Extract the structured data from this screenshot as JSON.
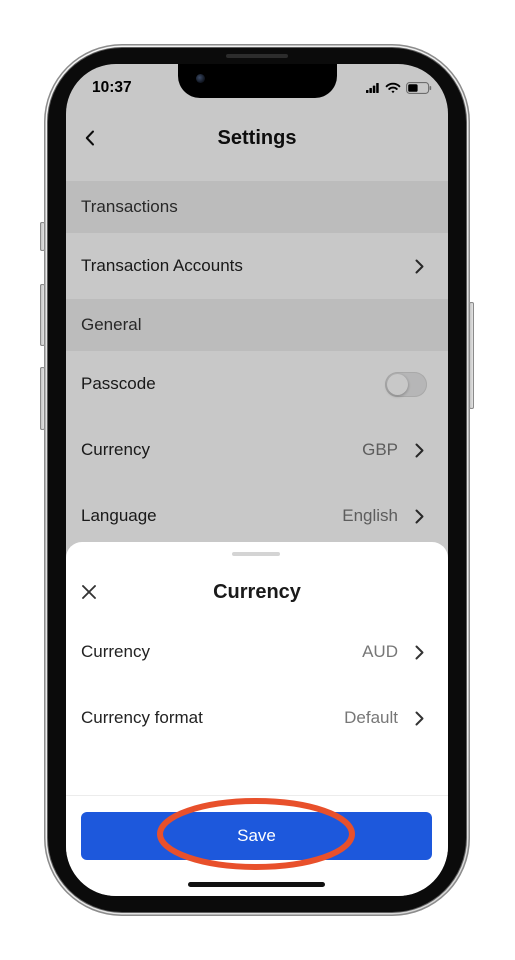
{
  "status_bar": {
    "time": "10:37",
    "signal_bars": 4,
    "signal_bars_max": 4,
    "battery_level": 0.5,
    "icons": {
      "signal": "signal-icon",
      "wifi": "wifi-icon",
      "battery": "battery-icon"
    }
  },
  "settings": {
    "title": "Settings",
    "back_icon": "chevron-left-icon",
    "sections": [
      {
        "header": "Transactions",
        "rows": [
          {
            "label": "Transaction Accounts",
            "accessory_icon": "chevron-right-icon"
          }
        ]
      },
      {
        "header": "General",
        "rows": [
          {
            "label": "Passcode",
            "toggle_on": false
          },
          {
            "label": "Currency",
            "value": "GBP",
            "accessory_icon": "chevron-right-icon"
          },
          {
            "label": "Language",
            "value": "English",
            "accessory_icon": "chevron-right-icon"
          }
        ]
      }
    ]
  },
  "currency_sheet": {
    "title": "Currency",
    "close_icon": "close-icon",
    "rows": [
      {
        "label": "Currency",
        "value": "AUD",
        "accessory_icon": "chevron-right-icon"
      },
      {
        "label": "Currency format",
        "value": "Default",
        "accessory_icon": "chevron-right-icon"
      }
    ],
    "save_label": "Save"
  },
  "colors": {
    "page_background": "#ffffff",
    "section_header_background": "#f0f0f0",
    "backdrop": "#00000037",
    "sheet_background": "#ffffff",
    "save_button": "#1d58dc",
    "save_button_text": "#ffffff",
    "highlight": "#e8502b"
  }
}
